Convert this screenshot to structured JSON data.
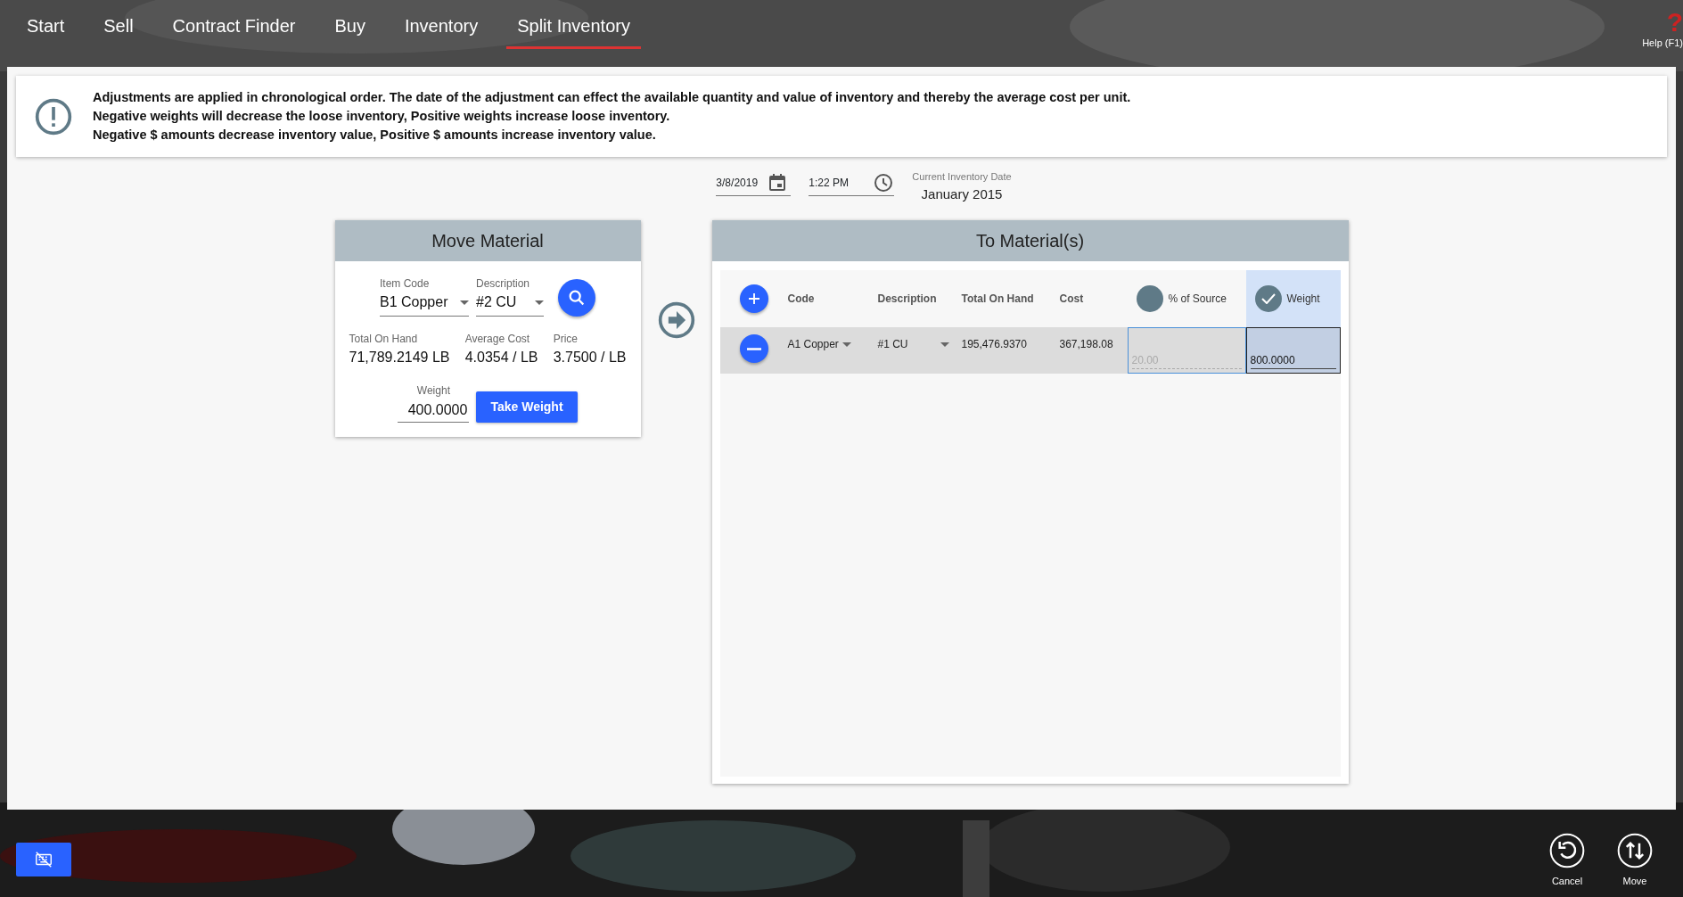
{
  "nav": {
    "tabs": [
      {
        "label": "Start",
        "selected": false
      },
      {
        "label": "Sell",
        "selected": false
      },
      {
        "label": "Contract Finder",
        "selected": false
      },
      {
        "label": "Buy",
        "selected": false
      },
      {
        "label": "Inventory",
        "selected": false
      },
      {
        "label": "Split Inventory",
        "selected": true
      }
    ],
    "help": {
      "glyph": "?",
      "label": "Help (F1)"
    }
  },
  "notice": {
    "lines": [
      "Adjustments are applied in chronological order. The date of the adjustment can effect the available quantity and value of inventory and thereby the average cost per unit.",
      "Negative weights will decrease the loose inventory, Positive weights increase loose inventory.",
      "Negative $ amounts decrease inventory value, Positive $ amounts increase inventory value."
    ]
  },
  "date_bar": {
    "date": "3/8/2019",
    "time": "1:22 PM",
    "current_label": "Current Inventory Date",
    "current_value": "January 2015"
  },
  "move_material": {
    "title": "Move Material",
    "item_code": {
      "label": "Item Code",
      "value": "B1 Copper"
    },
    "description": {
      "label": "Description",
      "value": "#2 CU"
    },
    "stats": [
      {
        "label": "Total On Hand",
        "value": "71,789.2149 LB"
      },
      {
        "label": "Average Cost",
        "value": "4.0354 / LB"
      },
      {
        "label": "Price",
        "value": "3.7500 / LB"
      }
    ],
    "weight": {
      "label": "Weight",
      "value": "400.0000"
    },
    "take_weight_button": "Take Weight"
  },
  "to_materials": {
    "title": "To Material(s)",
    "columns": [
      "Code",
      "Description",
      "Total On Hand",
      "Cost"
    ],
    "modes": [
      {
        "label": "% of Source",
        "selected": false
      },
      {
        "label": "Weight",
        "selected": true
      }
    ],
    "rows": [
      {
        "code": "A1 Copper",
        "description": "#1 CU",
        "total_on_hand": "195,476.9370",
        "cost": "367,198.08",
        "percent": "20.00",
        "weight": "800.0000"
      }
    ]
  },
  "bottom_bar": {
    "buttons": [
      {
        "label": "Cancel",
        "kind": "undo"
      },
      {
        "label": "Move",
        "kind": "move"
      }
    ]
  }
}
